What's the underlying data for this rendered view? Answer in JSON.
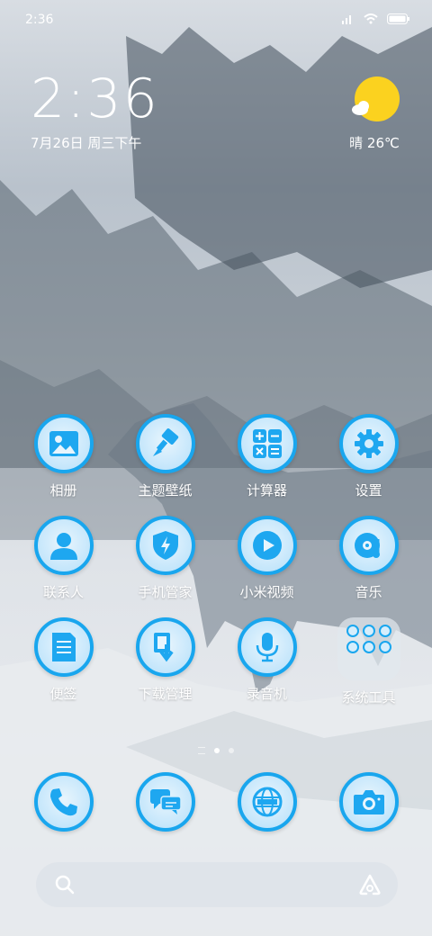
{
  "status_bar": {
    "time": "2:36"
  },
  "clock": {
    "time": "2:36",
    "date": "7月26日 周三下午"
  },
  "weather": {
    "text": "晴 26℃"
  },
  "apps": [
    {
      "label": "相册",
      "icon": "gallery-icon"
    },
    {
      "label": "主题壁纸",
      "icon": "brush-icon"
    },
    {
      "label": "计算器",
      "icon": "calculator-icon"
    },
    {
      "label": "设置",
      "icon": "gear-icon"
    },
    {
      "label": "联系人",
      "icon": "contacts-icon"
    },
    {
      "label": "手机管家",
      "icon": "security-shield-icon"
    },
    {
      "label": "小米视频",
      "icon": "play-icon"
    },
    {
      "label": "音乐",
      "icon": "music-icon"
    },
    {
      "label": "便签",
      "icon": "notes-icon"
    },
    {
      "label": "下载管理",
      "icon": "download-icon"
    },
    {
      "label": "录音机",
      "icon": "microphone-icon"
    },
    {
      "label": "系统工具",
      "icon": "folder-icon"
    }
  ],
  "page_indicator": {
    "pages": 2,
    "current": 1
  },
  "dock": [
    {
      "icon": "phone-icon"
    },
    {
      "icon": "messages-icon"
    },
    {
      "icon": "browser-icon"
    },
    {
      "icon": "camera-icon"
    }
  ],
  "colors": {
    "accent": "#19a6ee",
    "sun": "#fbd21f"
  }
}
